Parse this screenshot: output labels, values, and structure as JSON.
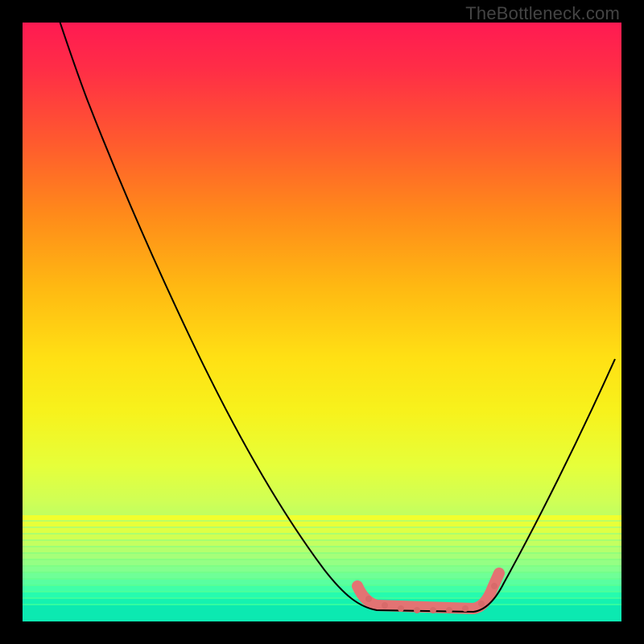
{
  "watermark": "TheBottleneck.com",
  "colors": {
    "background": "#000000",
    "curve": "#000000",
    "highlight": "#e37373"
  },
  "chart_data": {
    "type": "line",
    "title": "",
    "xlabel": "",
    "ylabel": "",
    "xlim": [
      0,
      100
    ],
    "ylim": [
      0,
      100
    ],
    "grid": false,
    "legend": false,
    "note": "Values estimated from pixel positions; y is percent of plot height from bottom.",
    "series": [
      {
        "name": "left-descent",
        "x": [
          6,
          10,
          15,
          20,
          25,
          30,
          35,
          40,
          45,
          50,
          55,
          57
        ],
        "y": [
          100,
          92,
          84,
          74,
          65,
          55,
          46,
          36,
          26,
          16,
          6,
          3
        ]
      },
      {
        "name": "trough",
        "x": [
          57,
          60,
          63,
          66,
          69,
          72,
          75,
          78,
          79
        ],
        "y": [
          3,
          2,
          1.5,
          1.5,
          1.5,
          1.5,
          2,
          4,
          6
        ]
      },
      {
        "name": "right-ascent",
        "x": [
          79,
          82,
          85,
          88,
          91,
          94,
          97,
          99
        ],
        "y": [
          6,
          12,
          19,
          27,
          35,
          43,
          51,
          56
        ]
      }
    ],
    "highlight_range_x": [
      56,
      80
    ]
  }
}
